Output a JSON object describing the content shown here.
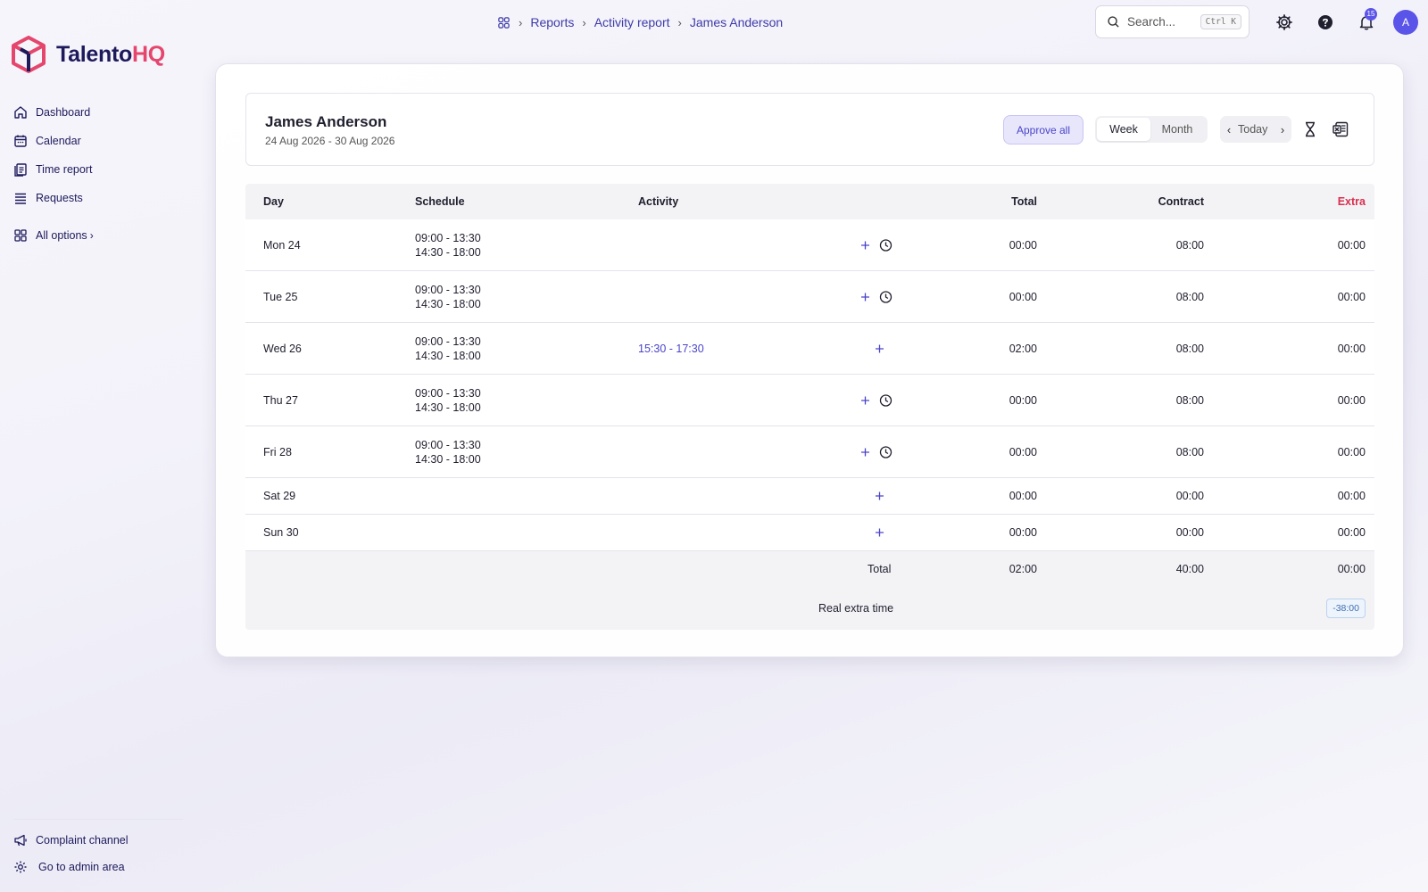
{
  "app": {
    "logo_part1": "Talento",
    "logo_part2": "HQ",
    "brand_colors": {
      "primary": "#1d1a5c",
      "accent": "#e5466d",
      "action": "#5b54e8"
    }
  },
  "sidebar": {
    "items": [
      {
        "label": "Dashboard",
        "icon": "home-icon"
      },
      {
        "label": "Calendar",
        "icon": "calendar-icon"
      },
      {
        "label": "Time report",
        "icon": "time-report-icon"
      },
      {
        "label": "Requests",
        "icon": "requests-icon"
      }
    ],
    "all_options": "All options",
    "bottom": [
      {
        "label": "Complaint channel",
        "icon": "megaphone-icon"
      },
      {
        "label": "Go to admin area",
        "icon": "gear-icon"
      }
    ]
  },
  "topbar": {
    "breadcrumb": [
      "Reports",
      "Activity report",
      "James Anderson"
    ],
    "search_placeholder": "Search...",
    "search_shortcut": "Ctrl K",
    "notifications_count": "15",
    "avatar_initial": "A"
  },
  "report": {
    "employee_name": "James Anderson",
    "date_range": "24 Aug 2026 - 30 Aug 2026",
    "approve_all": "Approve all",
    "view_week": "Week",
    "view_month": "Month",
    "today": "Today",
    "columns": {
      "day": "Day",
      "schedule": "Schedule",
      "activity": "Activity",
      "total": "Total",
      "contract": "Contract",
      "extra": "Extra"
    },
    "rows": [
      {
        "day": "Mon 24",
        "schedule1": "09:00 - 13:30",
        "schedule2": "14:30 - 18:00",
        "activity": "",
        "total": "00:00",
        "contract": "08:00",
        "extra": "00:00"
      },
      {
        "day": "Tue 25",
        "schedule1": "09:00 - 13:30",
        "schedule2": "14:30 - 18:00",
        "activity": "",
        "total": "00:00",
        "contract": "08:00",
        "extra": "00:00"
      },
      {
        "day": "Wed 26",
        "schedule1": "09:00 - 13:30",
        "schedule2": "14:30 - 18:00",
        "activity": "15:30 - 17:30",
        "total": "02:00",
        "contract": "08:00",
        "extra": "00:00"
      },
      {
        "day": "Thu 27",
        "schedule1": "09:00 - 13:30",
        "schedule2": "14:30 - 18:00",
        "activity": "",
        "total": "00:00",
        "contract": "08:00",
        "extra": "00:00"
      },
      {
        "day": "Fri 28",
        "schedule1": "09:00 - 13:30",
        "schedule2": "14:30 - 18:00",
        "activity": "",
        "total": "00:00",
        "contract": "08:00",
        "extra": "00:00"
      },
      {
        "day": "Sat 29",
        "activity": "",
        "total": "00:00",
        "contract": "00:00",
        "extra": "00:00"
      },
      {
        "day": "Sun 30",
        "activity": "",
        "total": "00:00",
        "contract": "00:00",
        "extra": "00:00"
      }
    ],
    "footer": {
      "total_label": "Total",
      "total": "02:00",
      "contract": "40:00",
      "extra": "00:00",
      "real_extra_label": "Real extra time",
      "real_extra_value": "-38:00"
    }
  }
}
